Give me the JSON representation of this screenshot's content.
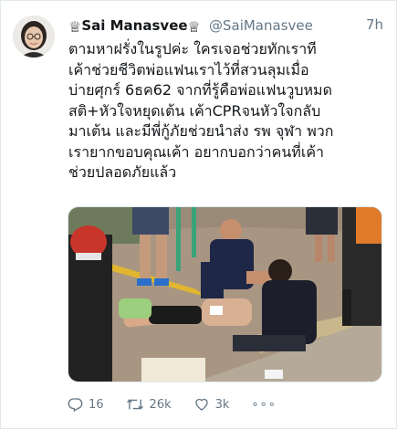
{
  "tweet": {
    "display_name": "Sai Manasvee",
    "crown_left": "♕",
    "crown_right": "♕",
    "handle": "@SaiManasvee",
    "time": "7h",
    "text": "ตามหาฝรั่งในรูปค่ะ ใครเจอช่วยทักเราที\nเค้าช่วยชีวิตพ่อแฟนเราไว้ที่สวนลุมเมื่อ\nบ่ายศุกร์ 6ธค62 จากที่รู้คือพ่อแฟนวูบหมด\nสติ+หัวใจหยุดเต้น เค้าCPRจนหัวใจกลับ\nมาเต้น และมีพี่กู้ภัยช่วยนำส่ง รพ จุฬา พวก\nเรายากขอบคุณเค้า อยากบอกว่าคนที่เค้า\nช่วยปลอดภัยแล้ว"
  },
  "actions": {
    "reply_count": "16",
    "retweet_count": "26k",
    "like_count": "3k",
    "more_label": "∘∘∘"
  },
  "icons": {
    "reply": "reply-icon",
    "retweet": "retweet-icon",
    "like": "heart-icon",
    "more": "more-icon"
  },
  "colors": {
    "text": "#14171a",
    "secondary": "#657786",
    "border": "#e1e8ed"
  }
}
